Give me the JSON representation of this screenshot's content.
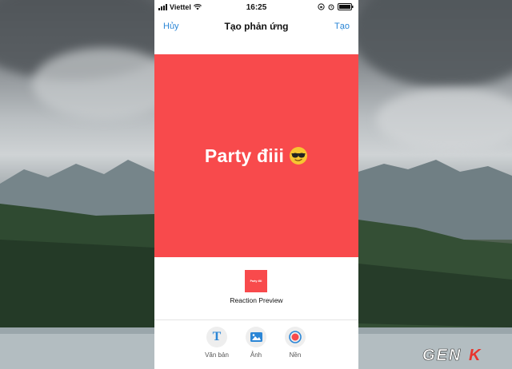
{
  "status_bar": {
    "carrier": "Viettel",
    "time": "16:25",
    "wifi_icon": "wifi-icon",
    "battery_icon": "battery-icon"
  },
  "nav": {
    "cancel_label": "Hủy",
    "title": "Tạo phản ứng",
    "create_label": "Tạo"
  },
  "reaction": {
    "text": "Party điii",
    "emoji_icon": "sunglasses-emoji-icon",
    "background_color": "#f84a4c",
    "text_color": "#ffffff"
  },
  "preview": {
    "thumb_text": "Party điii",
    "label": "Reaction Preview"
  },
  "toolbar": {
    "items": [
      {
        "label": "Văn bản",
        "icon": "text-icon"
      },
      {
        "label": "Ảnh",
        "icon": "image-icon"
      },
      {
        "label": "Nền",
        "icon": "background-icon"
      }
    ],
    "accent": "#2b86d6"
  },
  "watermark": {
    "text": "GENK"
  }
}
